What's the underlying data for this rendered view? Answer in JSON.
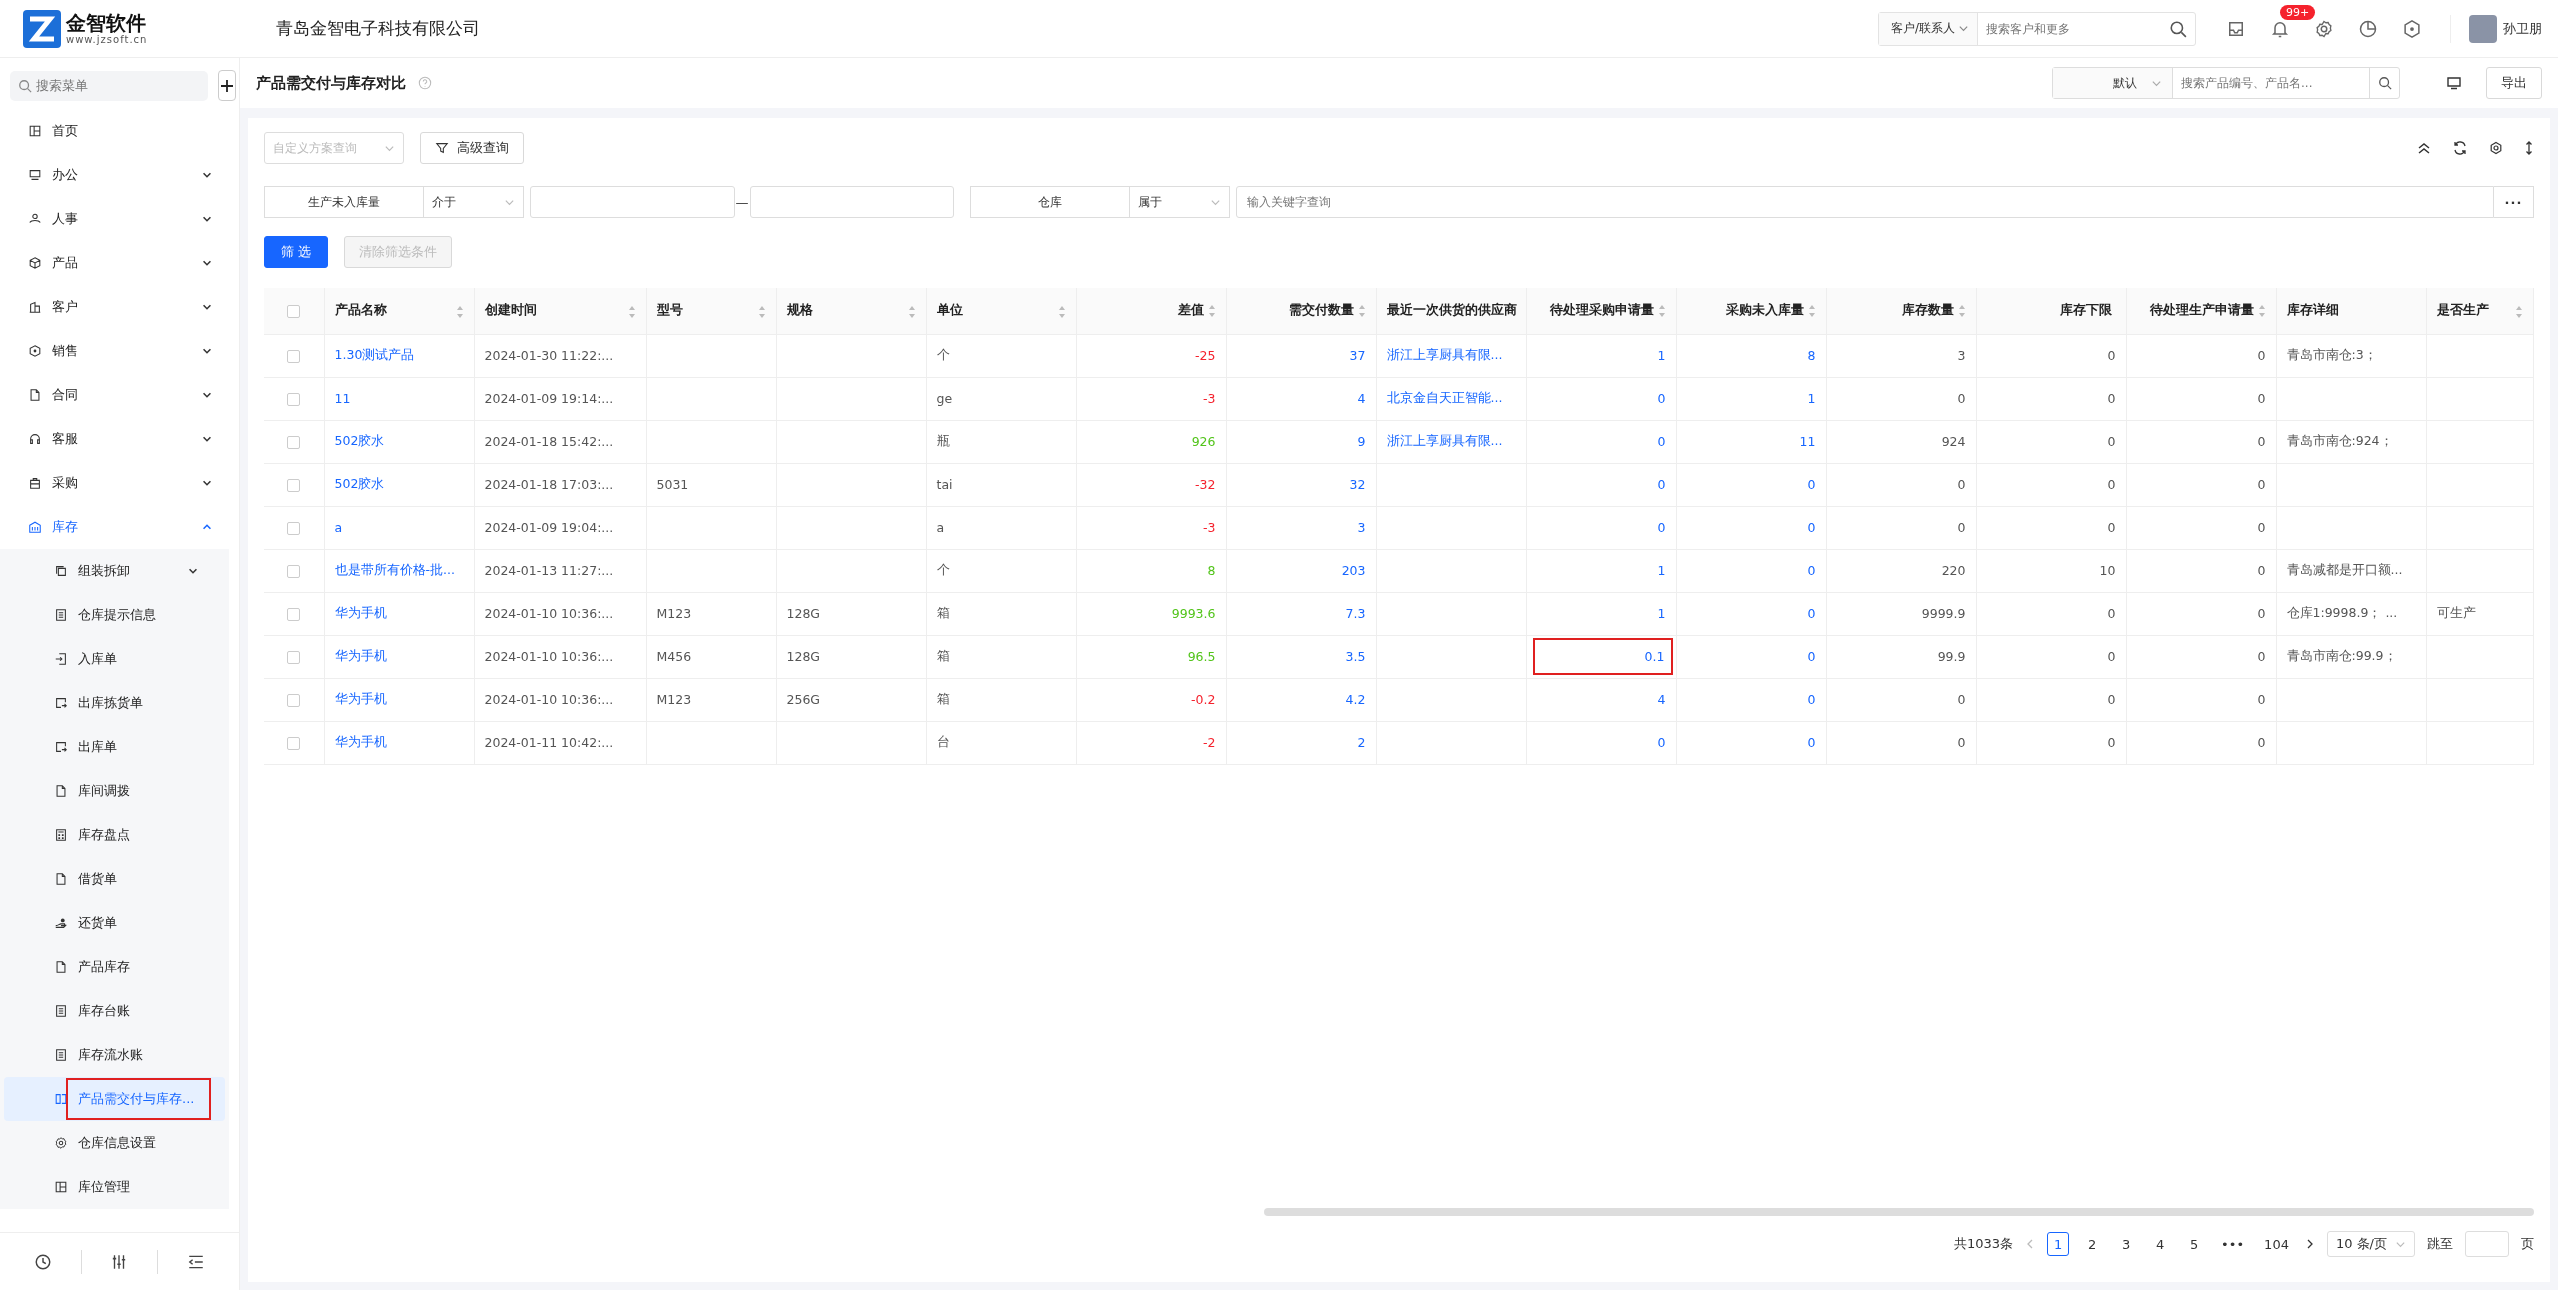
{
  "header": {
    "logo_title": "金智软件",
    "logo_url": "www.jzsoft.cn",
    "company": "青岛金智电子科技有限公司",
    "search_scope": "客户/联系人",
    "search_placeholder": "搜索客户和更多",
    "notification_badge": "99+",
    "user_name": "孙卫朋"
  },
  "sidebar": {
    "search_placeholder": "搜索菜单",
    "items": [
      {
        "label": "首页",
        "expandable": false,
        "expanded": false,
        "selected": false
      },
      {
        "label": "办公",
        "expandable": true,
        "expanded": false,
        "selected": false
      },
      {
        "label": "人事",
        "expandable": true,
        "expanded": false,
        "selected": false
      },
      {
        "label": "产品",
        "expandable": true,
        "expanded": false,
        "selected": false
      },
      {
        "label": "客户",
        "expandable": true,
        "expanded": false,
        "selected": false
      },
      {
        "label": "销售",
        "expandable": true,
        "expanded": false,
        "selected": false
      },
      {
        "label": "合同",
        "expandable": true,
        "expanded": false,
        "selected": false
      },
      {
        "label": "客服",
        "expandable": true,
        "expanded": false,
        "selected": false
      },
      {
        "label": "采购",
        "expandable": true,
        "expanded": false,
        "selected": false
      },
      {
        "label": "库存",
        "expandable": true,
        "expanded": true,
        "selected": false,
        "children": [
          {
            "label": "组装拆卸",
            "expandable": true,
            "expanded": false,
            "selected": false,
            "outlined": false
          },
          {
            "label": "仓库提示信息",
            "expandable": false,
            "expanded": false,
            "selected": false,
            "outlined": false
          },
          {
            "label": "入库单",
            "expandable": false,
            "expanded": false,
            "selected": false,
            "outlined": false
          },
          {
            "label": "出库拣货单",
            "expandable": false,
            "expanded": false,
            "selected": false,
            "outlined": false
          },
          {
            "label": "出库单",
            "expandable": false,
            "expanded": false,
            "selected": false,
            "outlined": false
          },
          {
            "label": "库间调拨",
            "expandable": false,
            "expanded": false,
            "selected": false,
            "outlined": false
          },
          {
            "label": "库存盘点",
            "expandable": false,
            "expanded": false,
            "selected": false,
            "outlined": false
          },
          {
            "label": "借货单",
            "expandable": false,
            "expanded": false,
            "selected": false,
            "outlined": false
          },
          {
            "label": "还货单",
            "expandable": false,
            "expanded": false,
            "selected": false,
            "outlined": false
          },
          {
            "label": "产品库存",
            "expandable": false,
            "expanded": false,
            "selected": false,
            "outlined": false
          },
          {
            "label": "库存台账",
            "expandable": false,
            "expanded": false,
            "selected": false,
            "outlined": false
          },
          {
            "label": "库存流水账",
            "expandable": false,
            "expanded": false,
            "selected": false,
            "outlined": false
          },
          {
            "label": "产品需交付与库存...",
            "expandable": false,
            "expanded": false,
            "selected": true,
            "outlined": true
          },
          {
            "label": "仓库信息设置",
            "expandable": false,
            "expanded": false,
            "selected": false,
            "outlined": false
          },
          {
            "label": "库位管理",
            "expandable": false,
            "expanded": false,
            "selected": false,
            "outlined": false
          }
        ]
      }
    ]
  },
  "page": {
    "title": "产品需交付与库存对比",
    "view_select": "默认",
    "search_placeholder": "搜索产品编号、产品名...",
    "export_button": "导出"
  },
  "filters": {
    "scheme_placeholder": "自定义方案查询",
    "advanced_button": "高级查询",
    "conditions": [
      {
        "kind": "range",
        "field": "生产未入库量",
        "operator": "介于",
        "separator": "—"
      },
      {
        "kind": "text",
        "field": "仓库",
        "operator": "属于",
        "placeholder": "输入关键字查询",
        "more": "···"
      }
    ],
    "apply_button": "筛 选",
    "clear_button": {
      "label": "清除筛选条件",
      "disabled": true
    }
  },
  "table": {
    "all_checked": false,
    "columns": [
      {
        "label": "产品名称",
        "sortable": true,
        "link": true
      },
      {
        "label": "创建时间",
        "sortable": true,
        "link": false
      },
      {
        "label": "型号",
        "sortable": true,
        "link": false
      },
      {
        "label": "规格",
        "sortable": true,
        "link": false
      },
      {
        "label": "单位",
        "sortable": true,
        "link": false
      },
      {
        "label": "差值",
        "sortable": true,
        "link": false
      },
      {
        "label": "需交付数量",
        "sortable": true,
        "link": true
      },
      {
        "label": "最近一次供货的供应商",
        "sortable": false,
        "link": true
      },
      {
        "label": "待处理采购申请量",
        "sortable": true,
        "link": true
      },
      {
        "label": "采购未入库量",
        "sortable": true,
        "link": true
      },
      {
        "label": "库存数量",
        "sortable": true,
        "link": false
      },
      {
        "label": "库存下限",
        "sortable": false,
        "link": false
      },
      {
        "label": "待处理生产申请量",
        "sortable": true,
        "link": false
      },
      {
        "label": "库存详细",
        "sortable": false,
        "link": false
      },
      {
        "label": "是否生产",
        "sortable": true,
        "link": false
      }
    ],
    "rows": [
      {
        "checked": false,
        "negative_diff": true,
        "pending_purchase_outlined": false,
        "cells": [
          "1.30测试产品",
          "2024-01-30 11:22:...",
          "",
          "",
          "个",
          "-25",
          "37",
          "浙江上享厨具有限...",
          "1",
          "8",
          "3",
          "0",
          "0",
          "青岛市南仓:3；",
          ""
        ]
      },
      {
        "checked": false,
        "negative_diff": true,
        "pending_purchase_outlined": false,
        "cells": [
          "11",
          "2024-01-09 19:14:...",
          "",
          "",
          "ge",
          "-3",
          "4",
          "北京金自天正智能...",
          "0",
          "1",
          "0",
          "0",
          "0",
          "",
          ""
        ]
      },
      {
        "checked": false,
        "negative_diff": false,
        "pending_purchase_outlined": false,
        "cells": [
          "502胶水",
          "2024-01-18 15:42:...",
          "",
          "",
          "瓶",
          "926",
          "9",
          "浙江上享厨具有限...",
          "0",
          "11",
          "924",
          "0",
          "0",
          "青岛市南仓:924；",
          ""
        ]
      },
      {
        "checked": false,
        "negative_diff": true,
        "pending_purchase_outlined": false,
        "cells": [
          "502胶水",
          "2024-01-18 17:03:...",
          "5031",
          "",
          "tai",
          "-32",
          "32",
          "",
          "0",
          "0",
          "0",
          "0",
          "0",
          "",
          ""
        ]
      },
      {
        "checked": false,
        "negative_diff": true,
        "pending_purchase_outlined": false,
        "cells": [
          "a",
          "2024-01-09 19:04:...",
          "",
          "",
          "a",
          "-3",
          "3",
          "",
          "0",
          "0",
          "0",
          "0",
          "0",
          "",
          ""
        ]
      },
      {
        "checked": false,
        "negative_diff": false,
        "pending_purchase_outlined": false,
        "cells": [
          "也是带所有价格-批...",
          "2024-01-13 11:27:...",
          "",
          "",
          "个",
          "8",
          "203",
          "",
          "1",
          "0",
          "220",
          "10",
          "0",
          "青岛减都是开口额...",
          ""
        ]
      },
      {
        "checked": false,
        "negative_diff": false,
        "pending_purchase_outlined": false,
        "cells": [
          "华为手机",
          "2024-01-10 10:36:...",
          "M123",
          "128G",
          "箱",
          "9993.6",
          "7.3",
          "",
          "1",
          "0",
          "9999.9",
          "0",
          "0",
          "仓库1:9998.9；  ...",
          "可生产"
        ]
      },
      {
        "checked": false,
        "negative_diff": false,
        "pending_purchase_outlined": true,
        "cells": [
          "华为手机",
          "2024-01-10 10:36:...",
          "M456",
          "128G",
          "箱",
          "96.5",
          "3.5",
          "",
          "0.1",
          "0",
          "99.9",
          "0",
          "0",
          "青岛市南仓:99.9；",
          ""
        ]
      },
      {
        "checked": false,
        "negative_diff": true,
        "pending_purchase_outlined": false,
        "cells": [
          "华为手机",
          "2024-01-10 10:36:...",
          "M123",
          "256G",
          "箱",
          "-0.2",
          "4.2",
          "",
          "4",
          "0",
          "0",
          "0",
          "0",
          "",
          ""
        ]
      },
      {
        "checked": false,
        "negative_diff": true,
        "pending_purchase_outlined": false,
        "cells": [
          "华为手机",
          "2024-01-11 10:42:...",
          "",
          "",
          "台",
          "-2",
          "2",
          "",
          "0",
          "0",
          "0",
          "0",
          "0",
          "",
          ""
        ]
      }
    ]
  },
  "pagination": {
    "total": "共1033条",
    "pages": [
      {
        "label": "1",
        "selected": true
      },
      {
        "label": "2",
        "selected": false
      },
      {
        "label": "3",
        "selected": false
      },
      {
        "label": "4",
        "selected": false
      },
      {
        "label": "5",
        "selected": false
      },
      {
        "label": "•••",
        "selected": false
      },
      {
        "label": "104",
        "selected": false
      }
    ],
    "page_size": "10 条/页",
    "jump_label": "跳至",
    "page_unit": "页"
  }
}
